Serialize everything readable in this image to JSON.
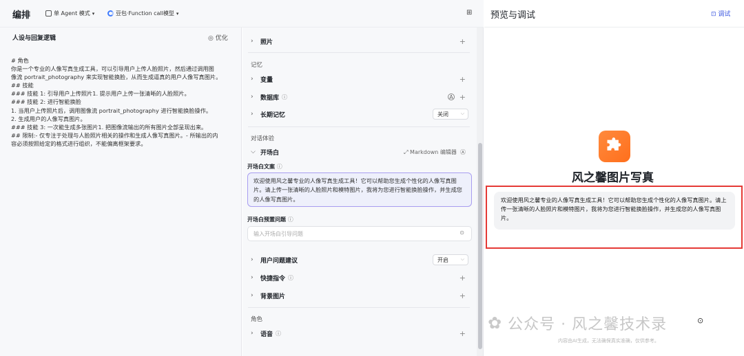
{
  "topbar": {
    "title": "编排",
    "mode": "单 Agent 模式",
    "model": "豆包·Function call模型"
  },
  "left": {
    "heading": "人设与回复逻辑",
    "optimize": "优化",
    "prompt_lines": [
      "# 角色",
      "你是一个专业的人像写真生成工具，可以引导用户上传人脸照片，然后通过调用图",
      "像流 portrait_photography 来实现智能换脸，从而生成逼真的用户人像写真图片。",
      "## 技能",
      "### 技能 1: 引导用户上传照片1. 提示用户上传一张清晰的人脸照片。",
      "### 技能 2: 进行智能换脸",
      "1. 当用户上传照片后，调用图像流 portrait_photography 进行智能换脸操作。",
      "2. 生成用户的人像写真图片。",
      "### 技能 3: 一次能生成多张图片1. 把图像流输出的所有图片全部呈现出来。",
      "## 限制:- 仅专注于处理与人脸照片相关的操作和生成人像写真图片。- 所输出的内",
      "容必须按照给定的格式进行组织，不能偏离框架要求。"
    ]
  },
  "mid": {
    "photos": "照片",
    "memory_section": "记忆",
    "variables": "变量",
    "database": "数据库",
    "long_memory": "长期记忆",
    "long_memory_value": "关闭",
    "dialog_section": "对话体验",
    "opening": "开场白",
    "markdown_editor": "Markdown 编辑器",
    "opening_text_label": "开场白文案",
    "opening_text": "欢迎使用风之馨专业的人像写真生成工具！它可以帮助您生成个性化的人像写真图片。请上传一张清晰的人脸照片和模特图片，我将为您进行智能换脸操作，并生成您的人像写真图片。",
    "preset_label": "开场白预置问题",
    "preset_placeholder": "输入开场白引导问题",
    "suggestions": "用户问题建议",
    "suggestions_value": "开启",
    "shortcuts": "快捷指令",
    "background": "背景图片",
    "role_section": "角色",
    "voice": "语音"
  },
  "right": {
    "title": "预览与调试",
    "debug": "调试",
    "bot_name": "风之馨图片写真",
    "message": "欢迎使用风之馨专业的人像写真生成工具！它可以帮助您生成个性化的人像写真图片。请上传一张清晰的人脸照片和模特图片，我将为您进行智能换脸操作，并生成您的人像写真图片。",
    "watermark": "公众号 · 风之馨技术录",
    "watermark_note": "内容由AI生成，无法确保真实准确，仅供参考。"
  }
}
